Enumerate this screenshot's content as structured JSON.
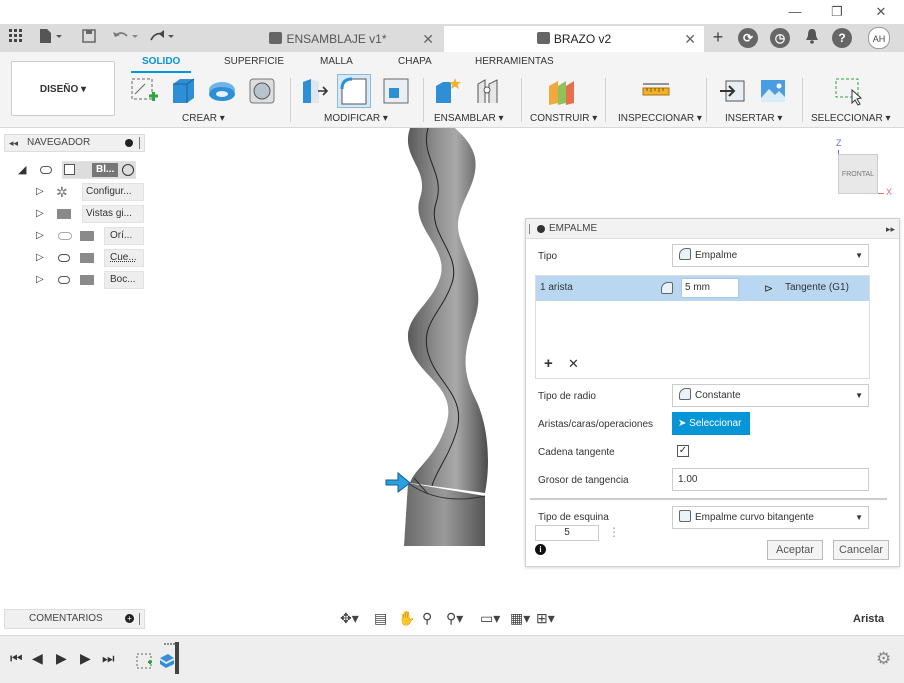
{
  "window": {
    "minimize": "—",
    "restore": "❐",
    "close": "✕"
  },
  "tabs": [
    {
      "label": "ENSAMBLAJE v1*",
      "close": "✕"
    },
    {
      "label": "BRAZO v2",
      "close": "✕"
    }
  ],
  "user_initials": "AH",
  "ribbon": {
    "design_menu": "DISEÑO ▾",
    "workspace_tabs": [
      "SOLIDO",
      "SUPERFICIE",
      "MALLA",
      "CHAPA",
      "HERRAMIENTAS"
    ],
    "groups": [
      "CREAR ▾",
      "MODIFICAR ▾",
      "ENSAMBLAR ▾",
      "CONSTRUIR ▾",
      "INSPECCIONAR ▾",
      "INSERTAR ▾",
      "SELECCIONAR ▾"
    ]
  },
  "browser": {
    "title": "NAVEGADOR",
    "root": "Bl...",
    "items": [
      "Configur...",
      "Vistas gi...",
      "Orí...",
      "Cue...",
      "Boc..."
    ]
  },
  "viewcube": {
    "face": "FRONTAL",
    "z": "Z",
    "x": "X"
  },
  "fillet": {
    "title": "EMPALME",
    "tipo_label": "Tipo",
    "tipo_value": "Empalme",
    "edge_count": "1 arista",
    "radius": "5 mm",
    "continuity": "Tangente (G1)",
    "add": "+",
    "remove": "✕",
    "radius_type_label": "Tipo de radio",
    "radius_type_value": "Constante",
    "edges_label": "Aristas/caras/operaciones",
    "select_button": "Seleccionar",
    "tangent_chain_label": "Cadena tangente",
    "tangent_chain_checked": true,
    "tangent_weight_label": "Grosor de tangencia",
    "tangent_weight_value": "1.00",
    "corner_type_label": "Tipo de esquina",
    "corner_type_value": "Empalme curvo bitangente",
    "setback": "5",
    "info": "i",
    "ok": "Aceptar",
    "cancel": "Cancelar"
  },
  "comments": {
    "title": "COMENTARIOS"
  },
  "status_text": "Arista",
  "colors": {
    "accent": "#0696d7",
    "selection": "#b9d7f1",
    "select_button": "#0696d7"
  }
}
